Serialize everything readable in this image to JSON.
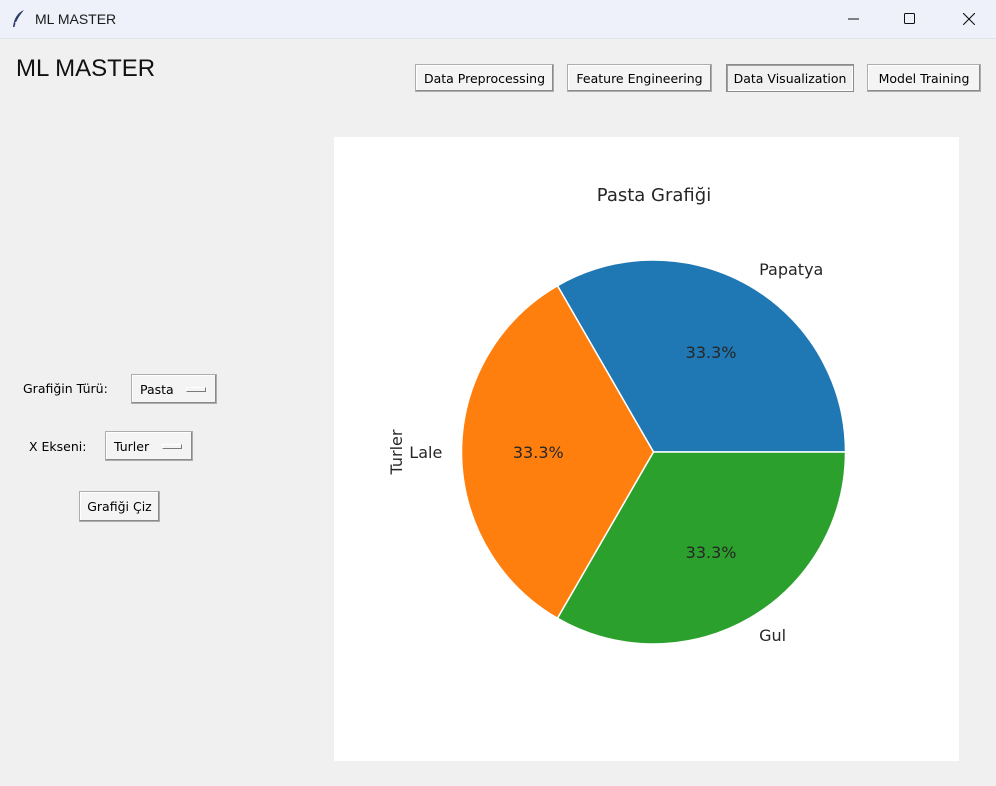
{
  "window": {
    "title": "ML MASTER"
  },
  "app": {
    "title": "ML MASTER"
  },
  "nav": {
    "buttons": [
      {
        "label": "Data Preprocessing"
      },
      {
        "label": "Feature Engineering"
      },
      {
        "label": "Data Visualization"
      },
      {
        "label": "Model Training"
      }
    ],
    "active": "Data Visualization"
  },
  "controls": {
    "chart_type_label": "Grafiğin Türü:",
    "chart_type_value": "Pasta",
    "x_axis_label": "X Ekseni:",
    "x_axis_value": "Turler",
    "draw_button": "Grafiği Çiz"
  },
  "icons": {
    "app": "feather-icon",
    "minimize": "minimize-icon",
    "maximize": "maximize-icon",
    "close": "close-icon"
  },
  "chart_data": {
    "type": "pie",
    "title": "Pasta Grafiği",
    "ylabel": "Turler",
    "categories": [
      "Papatya",
      "Lale",
      "Gul"
    ],
    "values": [
      1,
      1,
      1
    ],
    "percent_labels": [
      "33.3%",
      "33.3%",
      "33.3%"
    ],
    "colors": [
      "#1f77b4",
      "#ff7f0e",
      "#2ca02c"
    ],
    "start_angle_deg": 0
  }
}
